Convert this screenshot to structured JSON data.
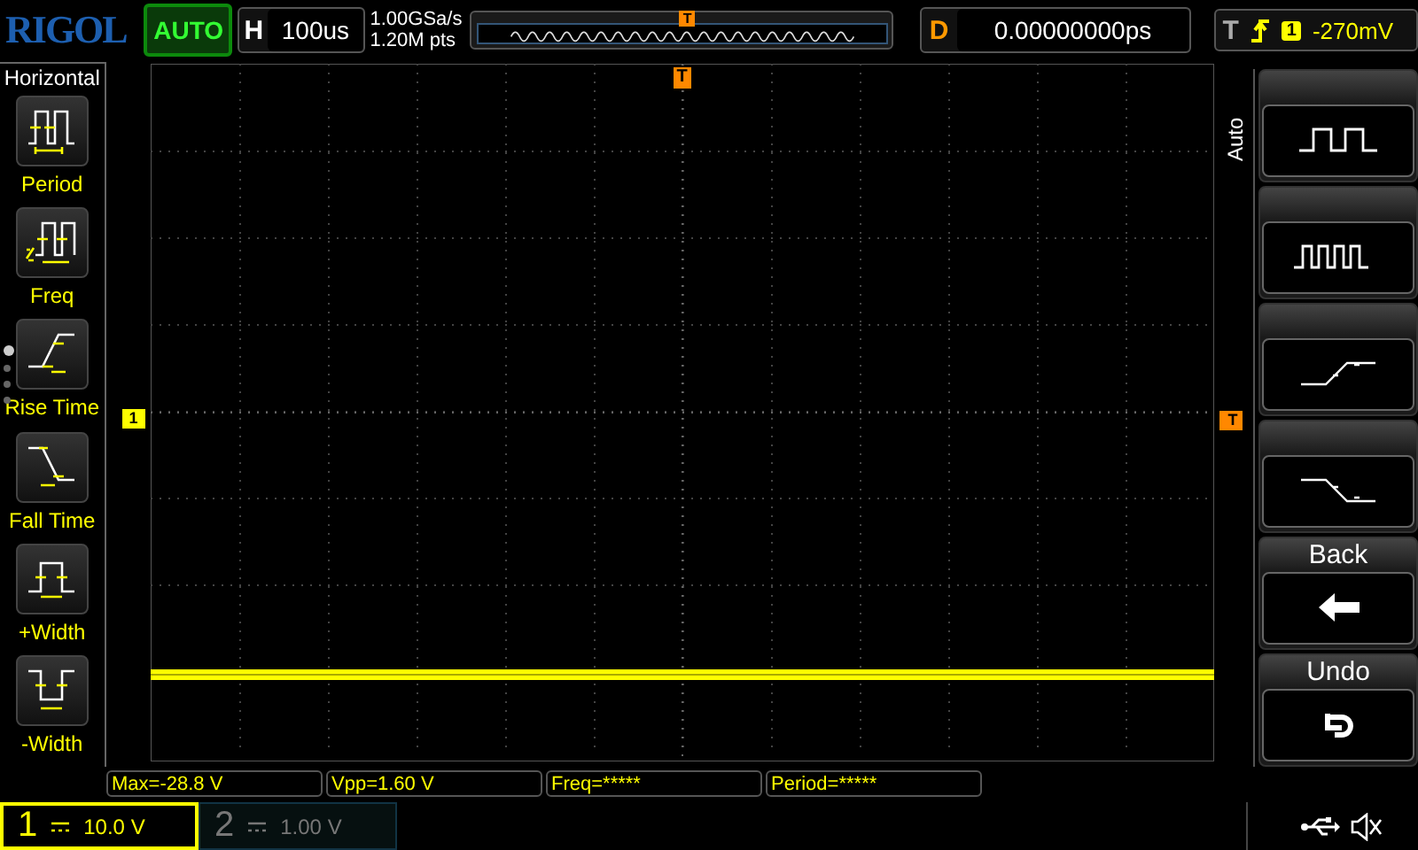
{
  "top_bar": {
    "logo": "RIGOL",
    "run_status": "AUTO",
    "timebase": {
      "label": "H",
      "value": "100us"
    },
    "sample_rate": "1.00GSa/s",
    "memory_depth": "1.20M pts",
    "trigger_position_marker": "T",
    "delay": {
      "label": "D",
      "value": "0.00000000ps"
    },
    "trigger": {
      "label": "T",
      "channel": "1",
      "level": "-270mV"
    }
  },
  "left_menu": {
    "title": "Horizontal",
    "pages": [
      {
        "selected": true
      },
      {
        "selected": false
      },
      {
        "selected": false
      },
      {
        "selected": false
      }
    ],
    "items": [
      {
        "kind": "period",
        "label": "Period"
      },
      {
        "kind": "freq",
        "label": "Freq"
      },
      {
        "kind": "rise",
        "label": "Rise Time"
      },
      {
        "kind": "fall",
        "label": "Fall Time"
      },
      {
        "kind": "pwidth",
        "label": "+Width"
      },
      {
        "kind": "nwidth",
        "label": "-Width"
      }
    ]
  },
  "grid": {
    "channel_marker": "1",
    "trigger_marker": "T",
    "trigger_level_marker": "T"
  },
  "right_menu": {
    "title": "Auto",
    "softkeys": [
      {
        "kind": "pulse"
      },
      {
        "kind": "pulses"
      },
      {
        "kind": "rise"
      },
      {
        "kind": "fall"
      },
      {
        "kind": "back",
        "label": "Back"
      },
      {
        "kind": "undo",
        "label": "Undo"
      }
    ]
  },
  "measurements": [
    "Max=-28.8 V",
    "Vpp=1.60 V",
    "Freq=*****",
    "Period=*****"
  ],
  "channels": [
    {
      "number": "1",
      "scale": "10.0 V",
      "on": true
    },
    {
      "number": "2",
      "scale": "1.00 V",
      "on": false
    }
  ]
}
